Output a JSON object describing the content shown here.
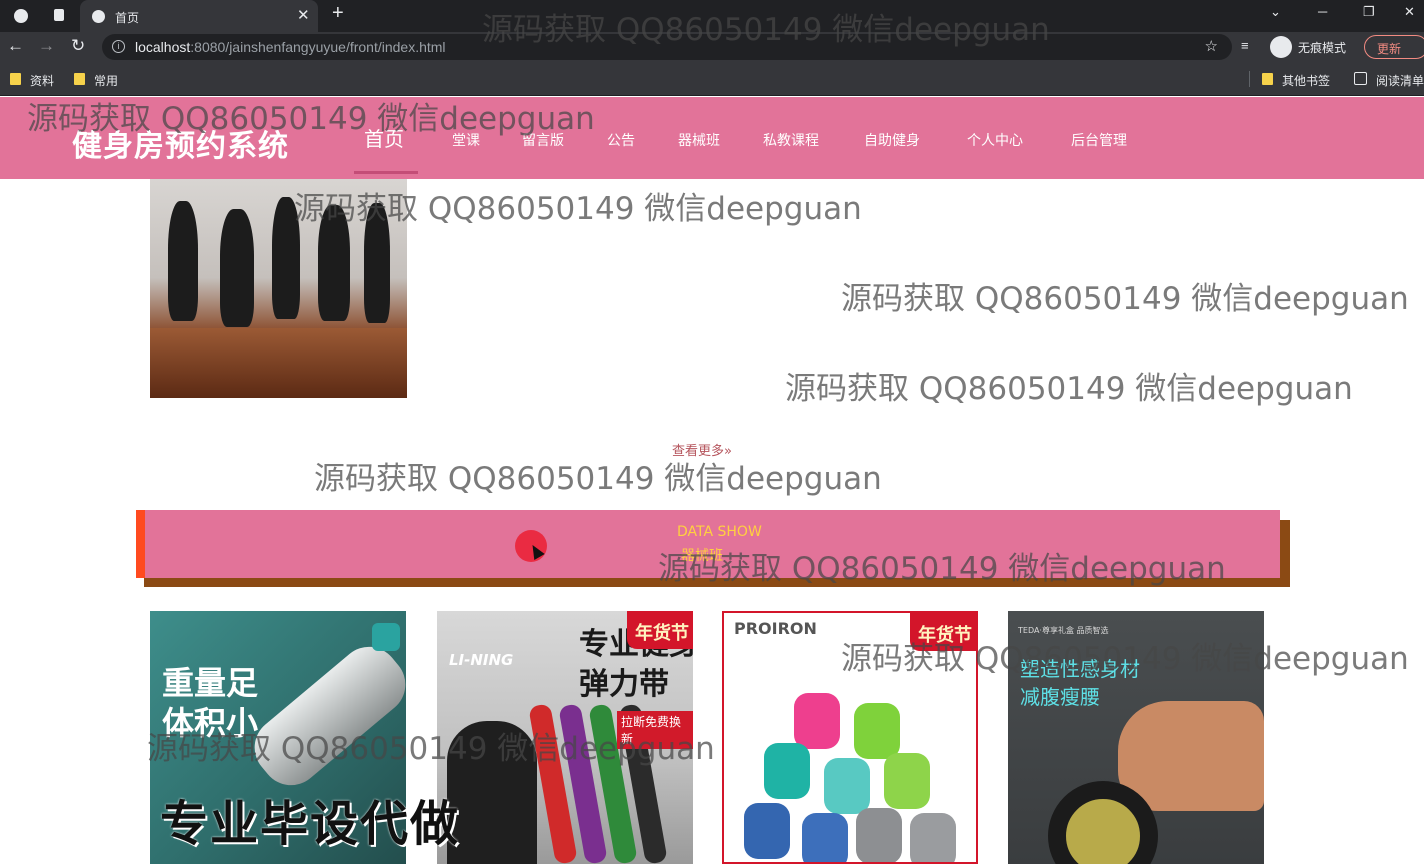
{
  "browser": {
    "tab_title": "首页",
    "url_host": "localhost",
    "url_rest": ":8080/jainshenfangyuyue/front/index.html",
    "incognito_label": "无痕模式",
    "update_label": "更新",
    "bookmarks": [
      "资料",
      "常用"
    ],
    "other_bookmarks": "其他书签",
    "reading_list": "阅读清单"
  },
  "site": {
    "logo": "健身房预约系统",
    "nav": [
      "首页",
      "堂课",
      "留言版",
      "公告",
      "器械班",
      "私教课程",
      "自助健身",
      "个人中心",
      "后台管理"
    ],
    "more_link": "查看更多»",
    "section_en": "DATA SHOW",
    "section_cn": "器械班"
  },
  "products": {
    "p1_text": "重量足\n体积小",
    "p2_brand": "LI-NING",
    "p2_headline": "专业健身\n弹力带",
    "p2_sub": "拉断免费换新",
    "p3_brand": "PROIRON",
    "tag": "年货节",
    "p4_small": "TEDA·尊享礼盒 品质智选",
    "p4_headline": "塑造性感身材\n减腹瘦腰"
  },
  "promo": "专业毕设代做",
  "watermark": "源码获取 QQ86050149 微信deepguan"
}
